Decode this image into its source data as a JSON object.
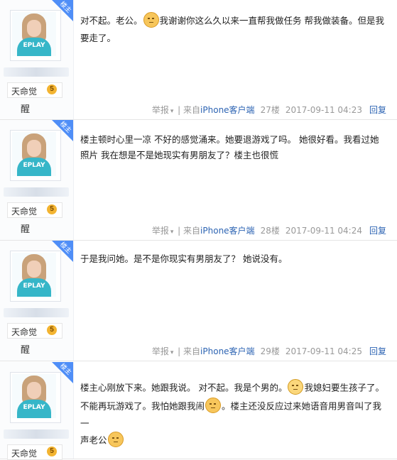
{
  "posts": [
    {
      "corner": "楼主",
      "shirt": "EPLAY",
      "rank_name": "天命觉",
      "rank_extra": "醒",
      "level": "5",
      "content": [
        "对不起。老公。",
        "我谢谢你这么久以来一直帮我做任务 帮我做装备。但是我要走了。"
      ],
      "footer": {
        "report": "举报",
        "source": "来自",
        "client": "iPhone客户端",
        "floor": "27楼",
        "time": "2017-09-11 04:23",
        "reply": "回复"
      }
    },
    {
      "corner": "楼主",
      "shirt": "EPLAY",
      "rank_name": "天命觉",
      "rank_extra": "醒",
      "level": "5",
      "content": [
        "楼主顿时心里一凉 不好的感觉涌来。她要退游戏了吗。 她很好看。我看过她照片 我在想是不是她现实有男朋友了？楼主也很慌"
      ],
      "footer": {
        "report": "举报",
        "source": "来自",
        "client": "iPhone客户端",
        "floor": "28楼",
        "time": "2017-09-11 04:24",
        "reply": "回复"
      }
    },
    {
      "corner": "楼主",
      "shirt": "EPLAY",
      "rank_name": "天命觉",
      "rank_extra": "醒",
      "level": "5",
      "content": [
        "于是我问她。是不是你现实有男朋友了？ 她说没有。"
      ],
      "footer": {
        "report": "举报",
        "source": "来自",
        "client": "iPhone客户端",
        "floor": "29楼",
        "time": "2017-09-11 04:25",
        "reply": "回复"
      }
    },
    {
      "corner": "楼主",
      "shirt": "EPLAY",
      "rank_name": "天命觉",
      "level": "5",
      "content": [
        "楼主心刚放下来。她跟我说。 对不起。我是个男的。",
        "我媳妇要生孩子了。",
        "不能再玩游戏了。我怕她跟我闹",
        "。楼主还没反应过来她语音用男音叫了我一",
        "声老公"
      ]
    }
  ]
}
